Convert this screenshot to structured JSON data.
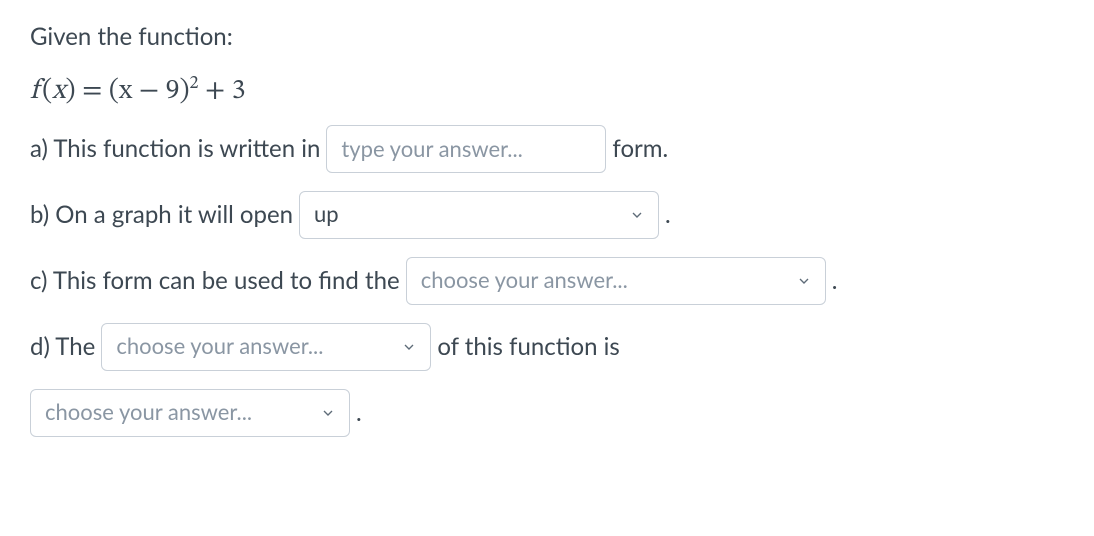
{
  "intro": "Given the function:",
  "formula": {
    "lhs_f": "f",
    "lhs_x": "x",
    "rhs_base": "(x − 9)",
    "rhs_exp": "2",
    "rhs_tail": " + 3"
  },
  "a": {
    "prefix": "a) This function is written in",
    "input_placeholder": "type your answer...",
    "input_value": "",
    "suffix": "form."
  },
  "b": {
    "prefix": "b) On a graph it will open",
    "select_value": "up",
    "period": "."
  },
  "c": {
    "prefix": "c) This form can be used to find the",
    "select_placeholder": "choose your answer...",
    "period": "."
  },
  "d": {
    "prefix": "d) The",
    "select1_placeholder": "choose your answer...",
    "middle": "of this function is",
    "select2_placeholder": "choose your answer...",
    "period": "."
  }
}
